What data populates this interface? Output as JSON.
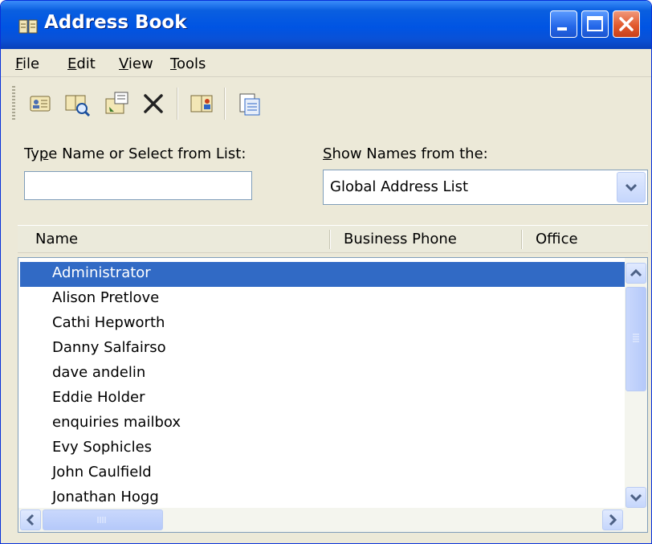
{
  "window": {
    "title": "Address Book"
  },
  "menu": [
    {
      "label": "File",
      "accel": "F",
      "rest": "ile"
    },
    {
      "label": "Edit",
      "accel": "E",
      "rest": "dit"
    },
    {
      "label": "View",
      "accel": "V",
      "rest": "iew"
    },
    {
      "label": "Tools",
      "accel": "T",
      "rest": "ools"
    }
  ],
  "toolbar": [
    "new-entry-icon",
    "find-items-icon",
    "properties-icon",
    "delete-icon",
    "add-to-contacts-icon",
    "advanced-find-icon"
  ],
  "search": {
    "label_accel": "p",
    "label_before": "Ty",
    "label_after": "e Name or Select from List:",
    "value": ""
  },
  "show_names": {
    "label_accel": "S",
    "label_rest": "how Names from the:",
    "selected": "Global Address List"
  },
  "columns": [
    "Name",
    "Business Phone",
    "Office"
  ],
  "rows": [
    {
      "name": "Administrator",
      "selected": true
    },
    {
      "name": "Alison Pretlove"
    },
    {
      "name": "Cathi Hepworth"
    },
    {
      "name": "Danny Salfairso"
    },
    {
      "name": "dave andelin"
    },
    {
      "name": "Eddie Holder"
    },
    {
      "name": "enquiries mailbox"
    },
    {
      "name": "Evy Sophicles"
    },
    {
      "name": "John Caulfield"
    },
    {
      "name": "Jonathan Hogg"
    }
  ],
  "colors": {
    "titlebar": "#0054E3",
    "selection": "#316AC5",
    "window_bg": "#ECE9D8"
  }
}
